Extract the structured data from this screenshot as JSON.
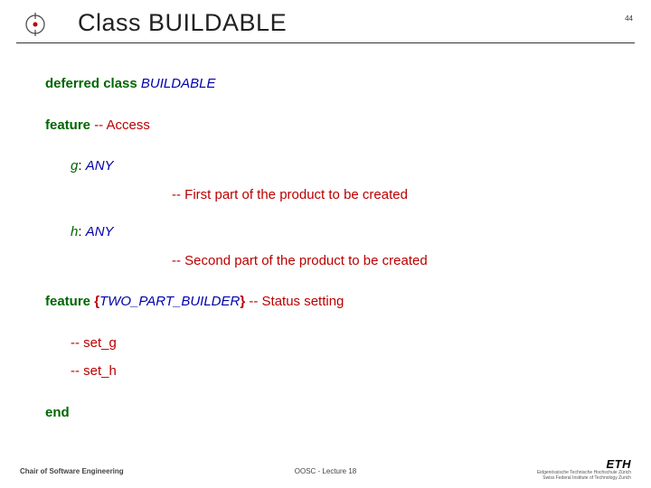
{
  "header": {
    "title": "Class BUILDABLE",
    "slide_number": "44"
  },
  "code": {
    "l1_kw": "deferred class ",
    "l1_cls": "BUILDABLE",
    "l2_kw": "feature ",
    "l2_comment": "-- Access",
    "l3_ident": "g",
    "l3_colon": ": ",
    "l3_type": "ANY",
    "l3_desc": "-- First part of the product to be created",
    "l4_ident": "h",
    "l4_colon": ": ",
    "l4_type": "ANY",
    "l4_desc": "-- Second part of the product to be created",
    "l5_kw": "feature ",
    "l5_brace_open": "{",
    "l5_cls": "TWO_PART_BUILDER",
    "l5_brace_close": "} ",
    "l5_comment": "-- Status setting",
    "l6_a": "-- set_g",
    "l6_b": "-- set_h",
    "l7_kw": "end"
  },
  "footer": {
    "left": "Chair of Software Engineering",
    "center": "OOSC - Lecture 18",
    "right_logo": "ETH",
    "right_sub1": "Eidgenössische Technische Hochschule Zürich",
    "right_sub2": "Swiss Federal Institute of Technology Zurich"
  }
}
